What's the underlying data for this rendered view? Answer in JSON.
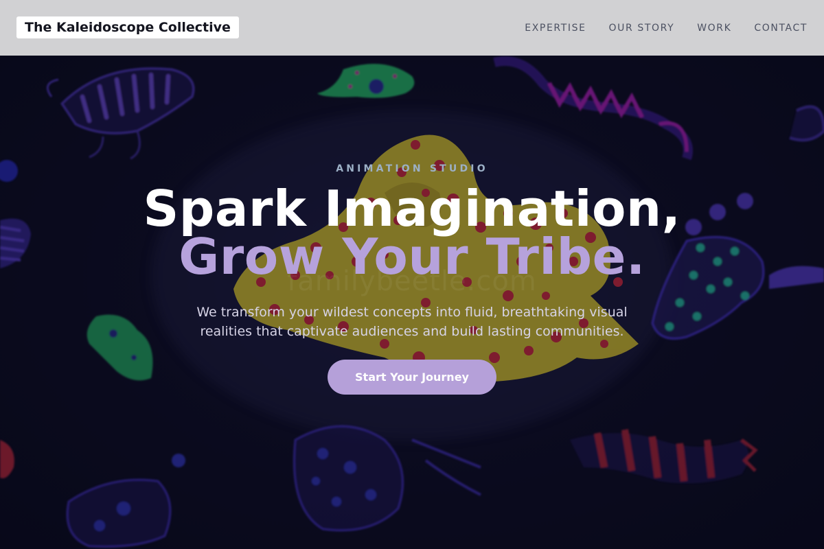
{
  "header": {
    "brand": "The Kaleidoscope Collective",
    "nav": [
      "EXPERTISE",
      "OUR STORY",
      "WORK",
      "CONTACT"
    ]
  },
  "hero": {
    "eyebrow": "ANIMATION STUDIO",
    "headline_line1": "Spark Imagination,",
    "headline_line2": "Grow Your Tribe.",
    "subtitle_line1": "We transform your wildest concepts into fluid, breathtaking visual",
    "subtitle_line2": "realities that captivate audiences and build lasting communities.",
    "cta": "Start Your Journey",
    "watermark": "familybeetle.com"
  },
  "colors": {
    "header_bg": "#d1d1d3",
    "hero_bg": "#0b0c1e",
    "accent_lavender": "#b6a2dc",
    "cta_bg": "#b5a0d9"
  }
}
